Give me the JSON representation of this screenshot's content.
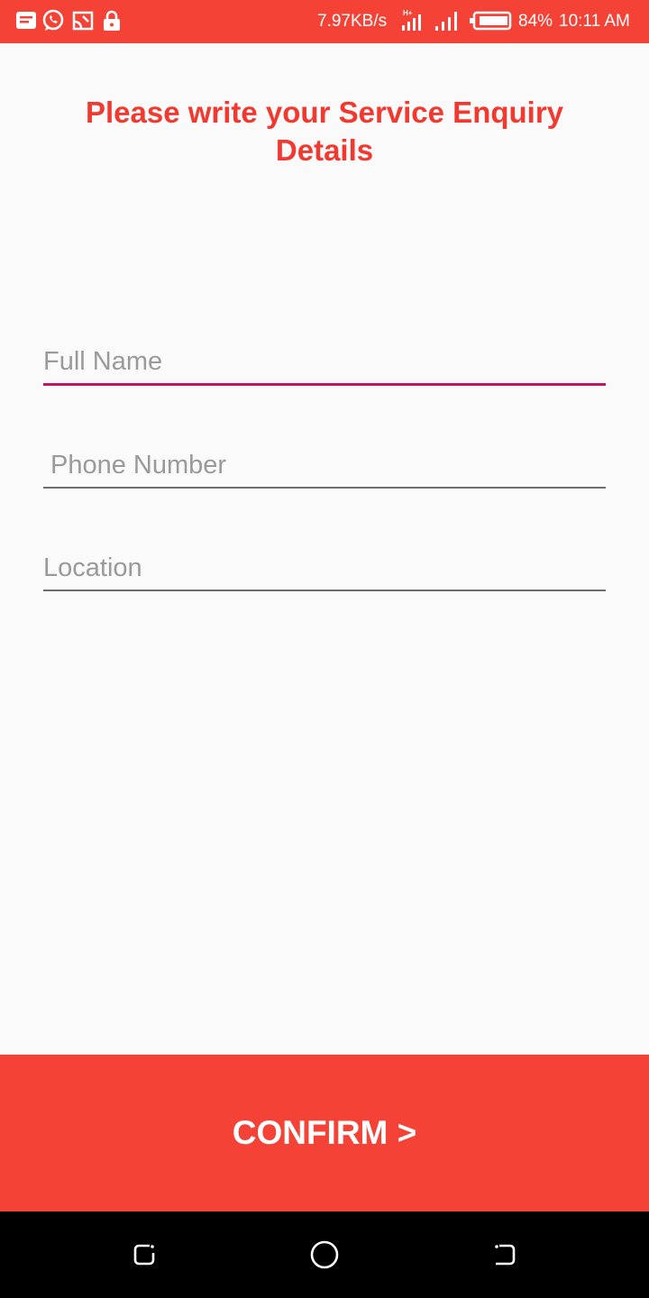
{
  "status_bar": {
    "net_speed": "7.97KB/s",
    "battery": "84%",
    "time": "10:11 AM",
    "icons": [
      "message-icon",
      "whatsapp-icon",
      "screen-cast-icon",
      "lock-icon",
      "network-h-plus-icon",
      "signal-icon",
      "battery-icon"
    ]
  },
  "title": "Please write your Service Enquiry Details",
  "form": {
    "full_name_placeholder": "Full Name",
    "phone_placeholder": "Phone Number",
    "location_placeholder": "Location"
  },
  "confirm_label": "CONFIRM >",
  "nav": {
    "icons": [
      "recent-apps-icon",
      "home-icon",
      "back-icon"
    ]
  },
  "colors": {
    "accent": "#f44336",
    "title": "#f2392f",
    "focus_underline": "#c2185b"
  }
}
